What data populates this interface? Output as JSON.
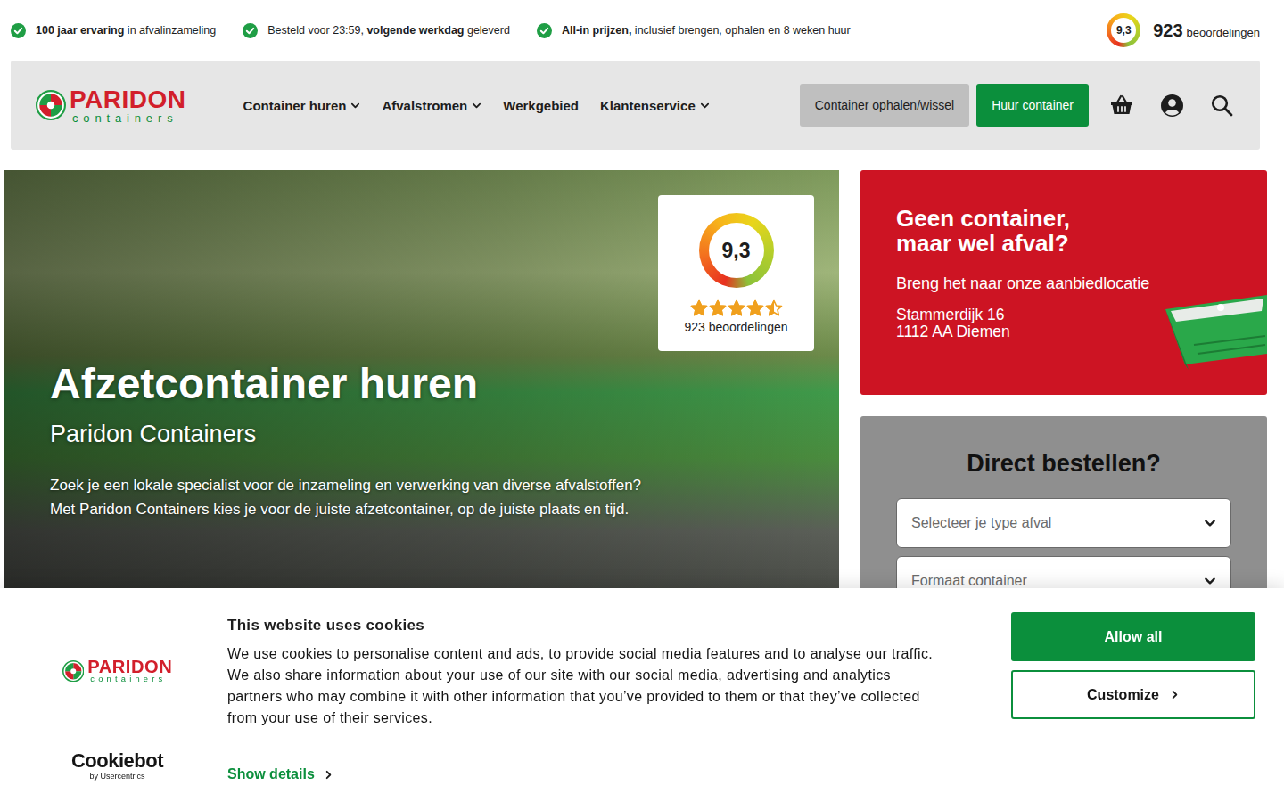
{
  "top_bar": {
    "usps": [
      {
        "parts": [
          {
            "text": "100 jaar ervaring",
            "bold": true
          },
          {
            "text": " in afvalinzameling",
            "bold": false
          }
        ]
      },
      {
        "parts": [
          {
            "text": "Besteld voor 23:59, ",
            "bold": false
          },
          {
            "text": "volgende werkdag",
            "bold": true
          },
          {
            "text": " geleverd",
            "bold": false
          }
        ]
      },
      {
        "parts": [
          {
            "text": "All-in prijzen,",
            "bold": true
          },
          {
            "text": " inclusief brengen, ophalen en 8 weken huur",
            "bold": false
          }
        ]
      }
    ],
    "rating": {
      "score": "9,3",
      "count": "923",
      "label": "beoordelingen"
    }
  },
  "nav": {
    "logo": {
      "name": "PARIDON",
      "tagline": "containers"
    },
    "items": [
      {
        "label": "Container huren",
        "has_menu": true
      },
      {
        "label": "Afvalstromen",
        "has_menu": true
      },
      {
        "label": "Werkgebied",
        "has_menu": false
      },
      {
        "label": "Klantenservice",
        "has_menu": true
      }
    ],
    "secondary_button": "Container ophalen/wissel",
    "primary_button": "Huur container"
  },
  "hero": {
    "title": "Afzetcontainer huren",
    "subtitle": "Paridon Containers",
    "paragraphs": [
      "Zoek je een lokale specialist voor de inzameling en verwerking van diverse afvalstoffen?",
      "Met Paridon Containers kies je voor de juiste afzetcontainer, op de juiste plaats en tijd."
    ],
    "rating": {
      "score": "9,3",
      "stars": 4.5,
      "count_label": "923 beoordelingen"
    }
  },
  "drop_off_card": {
    "heading_lines": [
      "Geen container,",
      "maar wel afval?"
    ],
    "text": "Breng het naar onze aanbiedlocatie",
    "address_lines": [
      "Stammerdijk 16",
      "1112 AA Diemen"
    ]
  },
  "order_card": {
    "title": "Direct bestellen?",
    "selects": [
      {
        "placeholder": "Selecteer je type afval"
      },
      {
        "placeholder": "Formaat container"
      }
    ]
  },
  "cookie_banner": {
    "logo": {
      "name": "PARIDON",
      "tagline": "containers"
    },
    "title": "This website uses cookies",
    "text": "We use cookies to personalise content and ads, to provide social media features and to analyse our traffic. We also share information about your use of our site with our social media, advertising and analytics partners who may combine it with other information that you’ve provided to them or that they’ve collected from your use of their services.",
    "show_details": "Show details",
    "allow_button": "Allow all",
    "customize_button": "Customize",
    "provider": {
      "name": "Cookiebot",
      "by": "by Usercentrics"
    }
  }
}
